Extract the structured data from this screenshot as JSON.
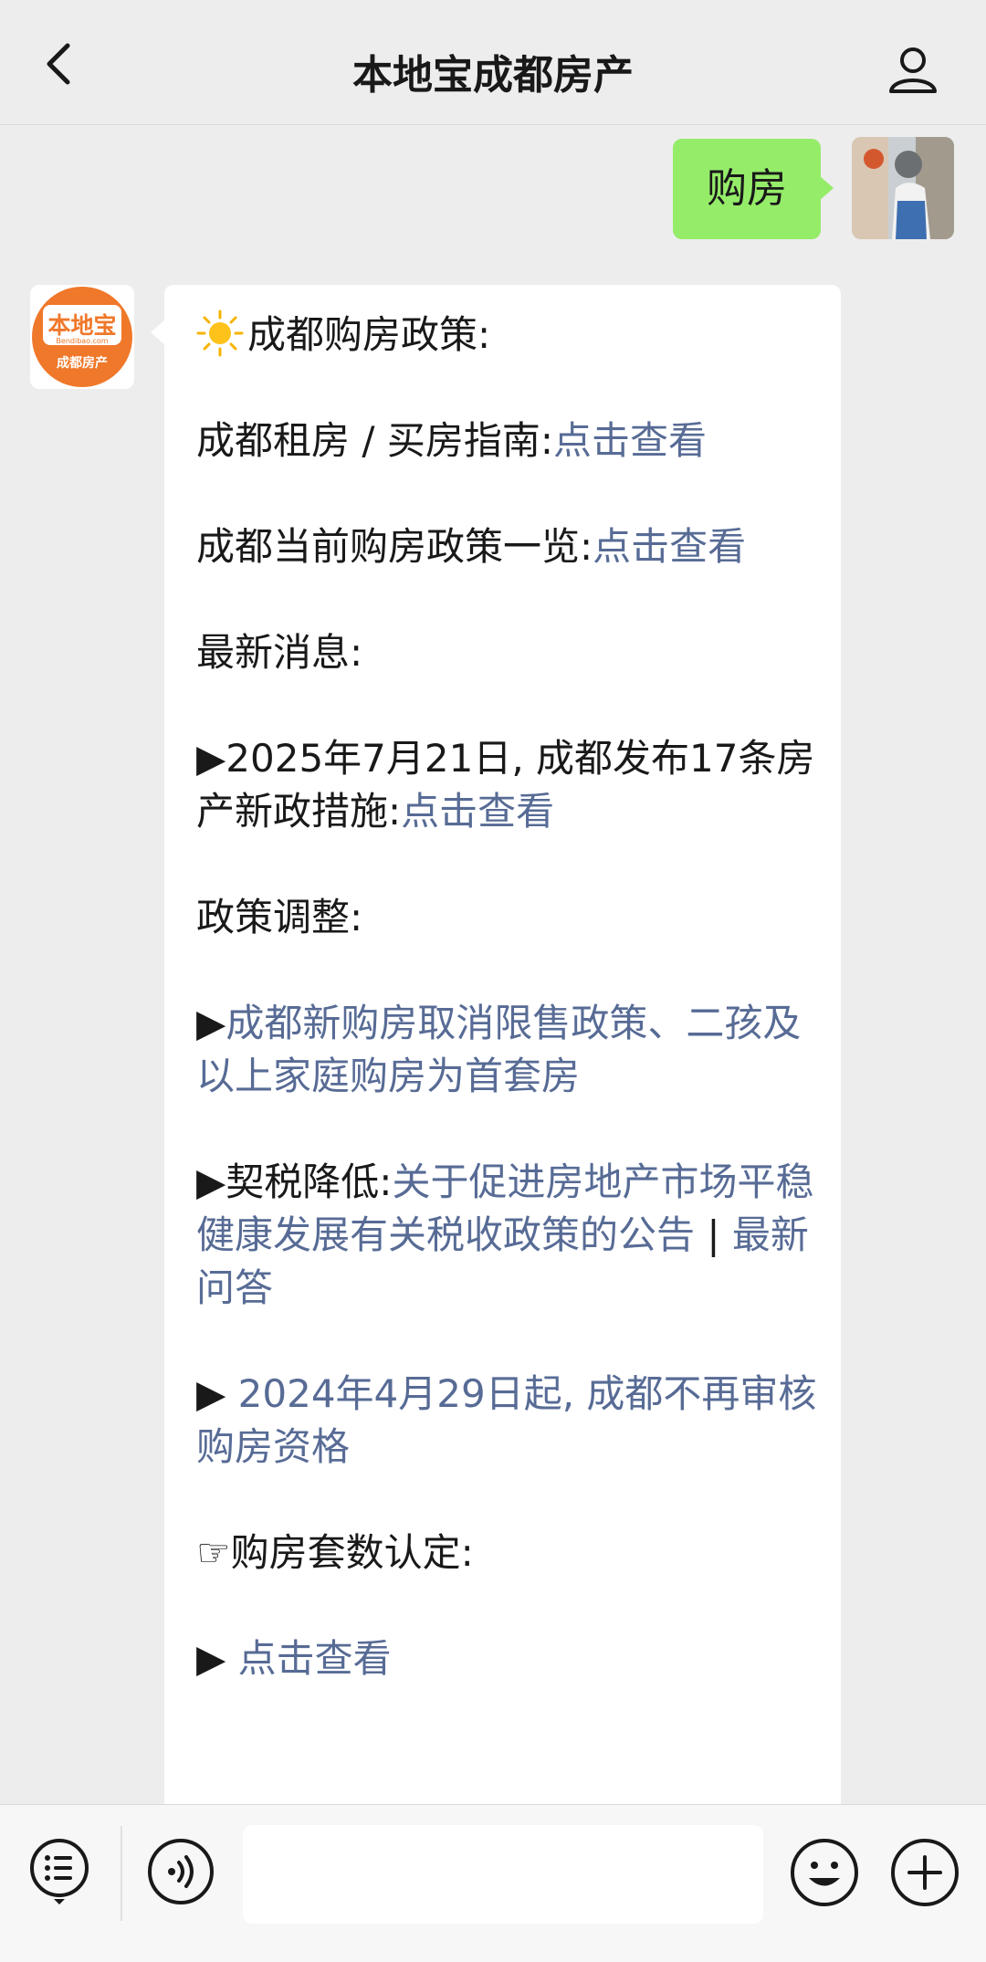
{
  "header": {
    "title": "本地宝成都房产"
  },
  "user_message": {
    "text": "购房"
  },
  "official_account": {
    "logo_text_main": "本地宝",
    "logo_text_domain": "Bendibao.com",
    "logo_text_sub": "成都房产"
  },
  "reply": {
    "heading": "成都购房政策:",
    "guide_label": "成都租房 / 买房指南:",
    "guide_link": "点击查看",
    "current_label": "成都当前购房政策一览:",
    "current_link": "点击查看",
    "news_heading": "最新消息:",
    "news_prefix": "▶2025年7月21日, 成都发布17条房产新政措施:",
    "news_link": "点击查看",
    "adjust_heading": "政策调整:",
    "adjust1_marker": "▶",
    "adjust1_link": "成都新购房取消限售政策、二孩及以上家庭购房为首套房",
    "adjust2_prefix": "▶契税降低:",
    "adjust2_link1": "关于促进房地产市场平稳健康发展有关税收政策的公告",
    "adjust2_separator": " | ",
    "adjust2_link2": "最新问答",
    "adjust3_marker": "▶ ",
    "adjust3_link": "2024年4月29日起, 成都不再审核购房资格",
    "count_heading": "☞购房套数认定:",
    "count_marker": "▶ ",
    "count_link": "点击查看"
  },
  "icons": {
    "back": "chevron-left-icon",
    "profile": "person-icon",
    "sun": "sun-icon",
    "menu": "menu-list-icon",
    "voice": "voice-icon",
    "emoji": "emoji-icon",
    "plus": "plus-icon"
  },
  "colors": {
    "link": "#576b95",
    "user_bubble": "#95ec69",
    "logo_orange": "#f0782a"
  }
}
